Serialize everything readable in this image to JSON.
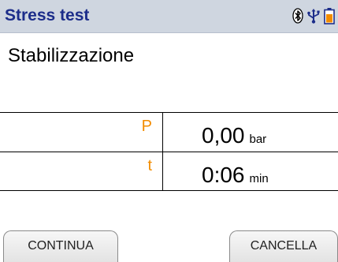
{
  "header": {
    "title": "Stress test",
    "icons": [
      "bluetooth-icon",
      "usb-icon",
      "battery-icon"
    ]
  },
  "message": "Stabilizzazione",
  "measurements": [
    {
      "label": "P",
      "value": "0,00",
      "unit": "bar"
    },
    {
      "label": "t",
      "value": "0:06",
      "unit": "min"
    }
  ],
  "softkeys": {
    "left_label": "CONTINUA",
    "right_label": "CANCELLA"
  },
  "colors": {
    "title_bar_bg": "#cfd6e0",
    "title_text": "#1c2d8a",
    "label_accent": "#f28c00"
  }
}
